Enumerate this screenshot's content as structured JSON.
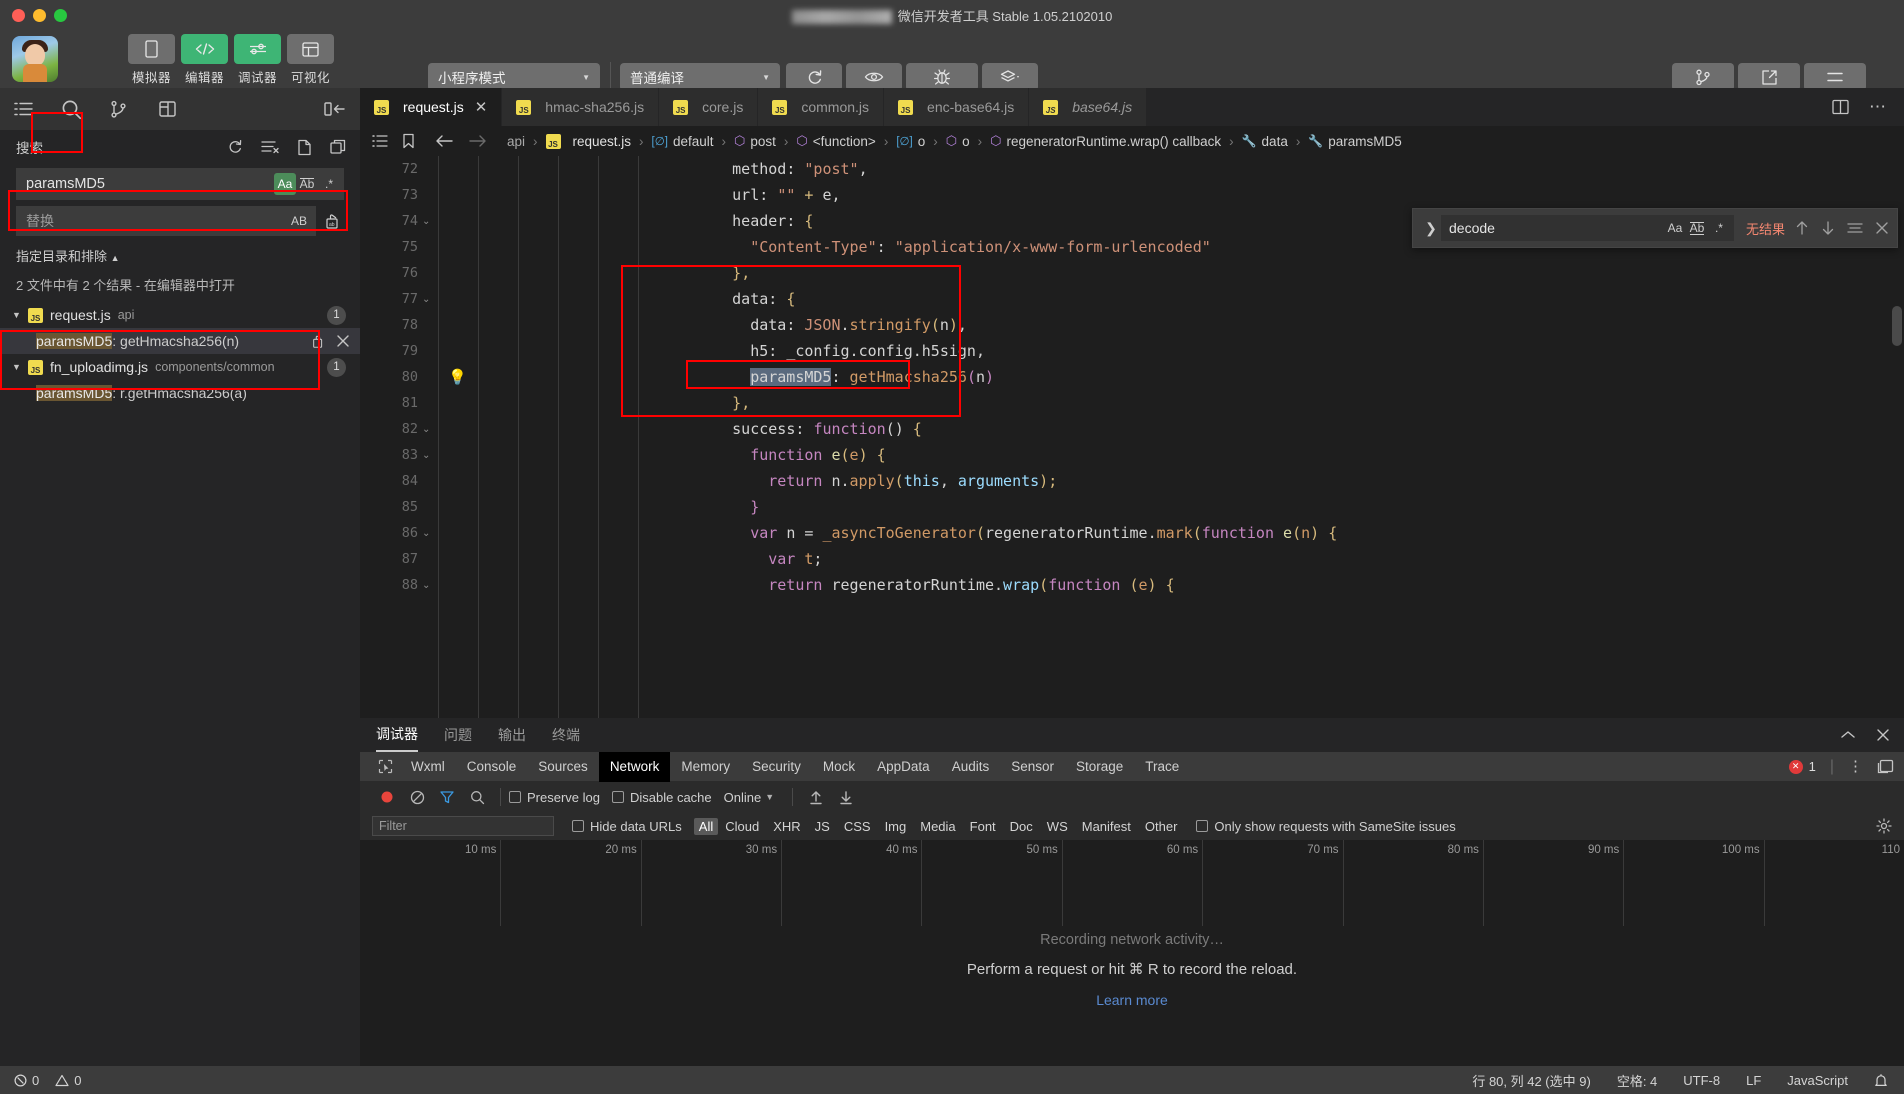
{
  "window": {
    "title": "微信开发者工具 Stable 1.05.2102010"
  },
  "toolbar": {
    "modes": [
      {
        "label": "模拟器",
        "icon": "phone-icon",
        "active": false
      },
      {
        "label": "编辑器",
        "icon": "code-icon",
        "active": true
      },
      {
        "label": "调试器",
        "icon": "sliders-icon",
        "active": true
      },
      {
        "label": "可视化",
        "icon": "layout-icon",
        "active": false
      }
    ],
    "mode_select": "小程序模式",
    "compile_select": "普通编译",
    "actions": [
      {
        "label": "编译",
        "icon": "refresh-icon"
      },
      {
        "label": "预览",
        "icon": "eye-icon"
      },
      {
        "label": "真机调试",
        "icon": "bug-icon"
      },
      {
        "label": "清缓存",
        "icon": "layers-icon"
      }
    ],
    "right_actions": [
      {
        "label": "版本管理",
        "icon": "branch-icon"
      },
      {
        "label": "测试号",
        "icon": "external-link-icon"
      },
      {
        "label": "详情",
        "icon": "hamburger-icon"
      }
    ]
  },
  "sidebar": {
    "activity_icons": [
      "files-icon",
      "search-icon",
      "source-control-icon",
      "extensions-icon"
    ],
    "active_activity": "search-icon",
    "panel_title": "搜索",
    "header_actions": [
      "refresh-icon",
      "clear-results-icon",
      "new-search-icon",
      "collapse-all-icon"
    ],
    "search": {
      "value": "paramsMD5",
      "placeholder": "搜索",
      "options": [
        {
          "name": "match-case",
          "label": "Aa",
          "active": true
        },
        {
          "name": "match-whole-word",
          "label": "Ab",
          "active": false
        },
        {
          "name": "use-regex",
          "label": ".*",
          "active": false
        }
      ]
    },
    "replace": {
      "placeholder": "替换",
      "option_label": "AB"
    },
    "include_exclude": "指定目录和排除",
    "results_summary": "2 文件中有 2 个结果 - 在编辑器中打开",
    "results": [
      {
        "file": "request.js",
        "path": "api",
        "count": "1",
        "expanded": true,
        "selected": true,
        "matches": [
          {
            "highlight": "paramsMD5",
            "rest": ": getHmacsha256(n)",
            "selected": true
          }
        ]
      },
      {
        "file": "fn_uploadimg.js",
        "path": "components/common",
        "count": "1",
        "expanded": true,
        "selected": false,
        "matches": [
          {
            "highlight": "paramsMD5",
            "rest": ": r.getHmacsha256(a)",
            "selected": false
          }
        ]
      }
    ]
  },
  "editor": {
    "tabs": [
      {
        "label": "request.js",
        "active": true,
        "italic": false,
        "closable": true
      },
      {
        "label": "hmac-sha256.js",
        "active": false,
        "italic": false,
        "closable": false
      },
      {
        "label": "core.js",
        "active": false,
        "italic": false,
        "closable": false
      },
      {
        "label": "common.js",
        "active": false,
        "italic": false,
        "closable": false
      },
      {
        "label": "enc-base64.js",
        "active": false,
        "italic": false,
        "closable": false
      },
      {
        "label": "base64.js",
        "active": false,
        "italic": true,
        "closable": false
      }
    ],
    "tab_actions": [
      "split-editor-icon",
      "more-actions-icon"
    ],
    "breadcrumb": [
      {
        "label": "api",
        "icon": "folder"
      },
      {
        "label": "request.js",
        "icon": "js"
      },
      {
        "label": "default",
        "icon": "module"
      },
      {
        "label": "post",
        "icon": "object"
      },
      {
        "label": "<function>",
        "icon": "object"
      },
      {
        "label": "o",
        "icon": "module"
      },
      {
        "label": "o",
        "icon": "object"
      },
      {
        "label": "regeneratorRuntime.wrap() callback",
        "icon": "object"
      },
      {
        "label": "data",
        "icon": "property"
      },
      {
        "label": "paramsMD5",
        "icon": "property"
      }
    ],
    "find_widget": {
      "value": "decode",
      "result_text": "无结果",
      "options": [
        {
          "name": "match-case",
          "label": "Aa"
        },
        {
          "name": "match-whole-word",
          "label": "Ab"
        },
        {
          "name": "use-regex",
          "label": ".*"
        }
      ],
      "actions": [
        "previous-match-icon",
        "next-match-icon",
        "find-in-selection-icon",
        "close-icon"
      ]
    },
    "code_lines": [
      {
        "n": "72",
        "fold": false,
        "indent": 8,
        "tokens": [
          {
            "t": "method",
            "c": "plain"
          },
          {
            "t": ": ",
            "c": "plain"
          },
          {
            "t": "\"post\"",
            "c": "str"
          },
          {
            "t": ",",
            "c": "plain"
          }
        ]
      },
      {
        "n": "73",
        "fold": false,
        "indent": 8,
        "tokens": [
          {
            "t": "url",
            "c": "plain"
          },
          {
            "t": ": ",
            "c": "plain"
          },
          {
            "t": "\"\"",
            "c": "str"
          },
          {
            "t": " + ",
            "c": "yel"
          },
          {
            "t": "e",
            "c": "plain"
          },
          {
            "t": ",",
            "c": "plain"
          }
        ]
      },
      {
        "n": "74",
        "fold": true,
        "indent": 8,
        "tokens": [
          {
            "t": "header",
            "c": "plain"
          },
          {
            "t": ": ",
            "c": "plain"
          },
          {
            "t": "{",
            "c": "yel"
          }
        ]
      },
      {
        "n": "75",
        "fold": false,
        "indent": 10,
        "tokens": [
          {
            "t": "\"Content-Type\"",
            "c": "str"
          },
          {
            "t": ": ",
            "c": "plain"
          },
          {
            "t": "\"application/x-www-form-urlencoded\"",
            "c": "str"
          }
        ]
      },
      {
        "n": "76",
        "fold": false,
        "indent": 8,
        "tokens": [
          {
            "t": "}",
            "c": "yel"
          },
          {
            "t": ",",
            "c": "yel"
          }
        ]
      },
      {
        "n": "77",
        "fold": true,
        "indent": 8,
        "tokens": [
          {
            "t": "data",
            "c": "plain"
          },
          {
            "t": ": ",
            "c": "plain"
          },
          {
            "t": "{",
            "c": "yel"
          }
        ]
      },
      {
        "n": "78",
        "fold": false,
        "indent": 10,
        "tokens": [
          {
            "t": "data",
            "c": "plain"
          },
          {
            "t": ": ",
            "c": "plain"
          },
          {
            "t": "JSON",
            "c": "str"
          },
          {
            "t": ".",
            "c": "plain"
          },
          {
            "t": "stringify",
            "c": "or"
          },
          {
            "t": "(",
            "c": "yel"
          },
          {
            "t": "n",
            "c": "plain"
          },
          {
            "t": ")",
            "c": "yel"
          },
          {
            "t": ",",
            "c": "plain"
          }
        ]
      },
      {
        "n": "79",
        "fold": false,
        "indent": 10,
        "tokens": [
          {
            "t": "h5",
            "c": "plain"
          },
          {
            "t": ": ",
            "c": "plain"
          },
          {
            "t": "_config",
            "c": "plain"
          },
          {
            "t": ".",
            "c": "plain"
          },
          {
            "t": "config",
            "c": "plain"
          },
          {
            "t": ".",
            "c": "plain"
          },
          {
            "t": "h5sign",
            "c": "plain"
          },
          {
            "t": ",",
            "c": "plain"
          }
        ]
      },
      {
        "n": "80",
        "fold": false,
        "indent": 10,
        "bulb": true,
        "tokens": [
          {
            "t": "paramsMD5",
            "c": "sel"
          },
          {
            "t": ": ",
            "c": "plain"
          },
          {
            "t": "getHmacsha256",
            "c": "or"
          },
          {
            "t": "(",
            "c": "key"
          },
          {
            "t": "n",
            "c": "plain"
          },
          {
            "t": ")",
            "c": "key"
          }
        ]
      },
      {
        "n": "81",
        "fold": false,
        "indent": 8,
        "tokens": [
          {
            "t": "}",
            "c": "yel"
          },
          {
            "t": ",",
            "c": "yel"
          }
        ]
      },
      {
        "n": "82",
        "fold": true,
        "indent": 8,
        "tokens": [
          {
            "t": "success",
            "c": "plain"
          },
          {
            "t": ": ",
            "c": "plain"
          },
          {
            "t": "function",
            "c": "key"
          },
          {
            "t": "() ",
            "c": "plain"
          },
          {
            "t": "{",
            "c": "yel"
          }
        ]
      },
      {
        "n": "83",
        "fold": true,
        "indent": 10,
        "tokens": [
          {
            "t": "function ",
            "c": "key"
          },
          {
            "t": "e",
            "c": "fn"
          },
          {
            "t": "(",
            "c": "yel"
          },
          {
            "t": "e",
            "c": "or"
          },
          {
            "t": ") ",
            "c": "yel"
          },
          {
            "t": "{",
            "c": "yel"
          }
        ]
      },
      {
        "n": "84",
        "fold": false,
        "indent": 12,
        "tokens": [
          {
            "t": "return ",
            "c": "key"
          },
          {
            "t": "n",
            "c": "plain"
          },
          {
            "t": ".",
            "c": "plain"
          },
          {
            "t": "apply",
            "c": "or"
          },
          {
            "t": "(",
            "c": "yel"
          },
          {
            "t": "this",
            "c": "var"
          },
          {
            "t": ", ",
            "c": "plain"
          },
          {
            "t": "arguments",
            "c": "var"
          },
          {
            "t": ");",
            "c": "yel"
          }
        ]
      },
      {
        "n": "85",
        "fold": false,
        "indent": 10,
        "tokens": [
          {
            "t": "}",
            "c": "key"
          }
        ]
      },
      {
        "n": "86",
        "fold": true,
        "indent": 10,
        "tokens": [
          {
            "t": "var ",
            "c": "key"
          },
          {
            "t": "n",
            "c": "plain"
          },
          {
            "t": " = ",
            "c": "plain"
          },
          {
            "t": "_asyncToGenerator",
            "c": "or"
          },
          {
            "t": "(",
            "c": "yel"
          },
          {
            "t": "regeneratorRuntime",
            "c": "plain"
          },
          {
            "t": ".",
            "c": "plain"
          },
          {
            "t": "mark",
            "c": "or"
          },
          {
            "t": "(",
            "c": "yel"
          },
          {
            "t": "function ",
            "c": "key"
          },
          {
            "t": "e",
            "c": "fn"
          },
          {
            "t": "(",
            "c": "yel"
          },
          {
            "t": "n",
            "c": "or"
          },
          {
            "t": ") ",
            "c": "yel"
          },
          {
            "t": "{",
            "c": "yel"
          }
        ]
      },
      {
        "n": "87",
        "fold": false,
        "indent": 12,
        "tokens": [
          {
            "t": "var ",
            "c": "key"
          },
          {
            "t": "t",
            "c": "or"
          },
          {
            "t": ";",
            "c": "plain"
          }
        ]
      },
      {
        "n": "88",
        "fold": true,
        "indent": 12,
        "tokens": [
          {
            "t": "return ",
            "c": "key"
          },
          {
            "t": "regeneratorRuntime",
            "c": "plain"
          },
          {
            "t": ".",
            "c": "plain"
          },
          {
            "t": "wrap",
            "c": "var"
          },
          {
            "t": "(",
            "c": "yel"
          },
          {
            "t": "function ",
            "c": "key"
          },
          {
            "t": "(",
            "c": "yel"
          },
          {
            "t": "e",
            "c": "or"
          },
          {
            "t": ") ",
            "c": "yel"
          },
          {
            "t": "{",
            "c": "yel"
          }
        ]
      }
    ]
  },
  "devtools": {
    "outer_tabs": [
      {
        "label": "调试器",
        "active": true
      },
      {
        "label": "问题",
        "active": false
      },
      {
        "label": "输出",
        "active": false
      },
      {
        "label": "终端",
        "active": false
      }
    ],
    "outer_actions": [
      "collapse-panel-icon",
      "close-panel-icon"
    ],
    "panels": [
      "Wxml",
      "Console",
      "Sources",
      "Network",
      "Memory",
      "Security",
      "Mock",
      "AppData",
      "Audits",
      "Sensor",
      "Storage",
      "Trace"
    ],
    "active_panel": "Network",
    "error_count": "1",
    "network_toolbar": {
      "record_label": "record-icon",
      "clear_label": "clear-icon",
      "filter_label": "filter-icon",
      "search_label": "search-icon",
      "preserve_log": "Preserve log",
      "disable_cache": "Disable cache",
      "throttling": "Online",
      "import_icon": "import-har-icon",
      "export_icon": "export-har-icon"
    },
    "network_filter": {
      "placeholder": "Filter",
      "hide_data_urls": "Hide data URLs",
      "types": [
        "All",
        "Cloud",
        "XHR",
        "JS",
        "CSS",
        "Img",
        "Media",
        "Font",
        "Doc",
        "WS",
        "Manifest",
        "Other"
      ],
      "active_type": "All",
      "samesite_label": "Only show requests with SameSite issues"
    },
    "timeline_ticks": [
      "10 ms",
      "20 ms",
      "30 ms",
      "40 ms",
      "50 ms",
      "60 ms",
      "70 ms",
      "80 ms",
      "90 ms",
      "100 ms",
      "110"
    ],
    "empty_state": {
      "line1": "Recording network activity…",
      "line2": "Perform a request or hit ⌘ R to record the reload.",
      "line3": "Learn more"
    }
  },
  "statusbar": {
    "left": [
      {
        "icon": "error-icon",
        "label": "0"
      },
      {
        "icon": "warning-icon",
        "label": "0"
      }
    ],
    "right": [
      "行 80, 列 42 (选中 9)",
      "空格: 4",
      "UTF-8",
      "LF",
      "JavaScript"
    ],
    "bell_icon": "bell-icon"
  },
  "colors": {
    "accent_green": "#3eb575",
    "annotation_red": "#ff0000",
    "selection_blue": "#5a6a7e",
    "match_highlight": "#6a5632"
  }
}
